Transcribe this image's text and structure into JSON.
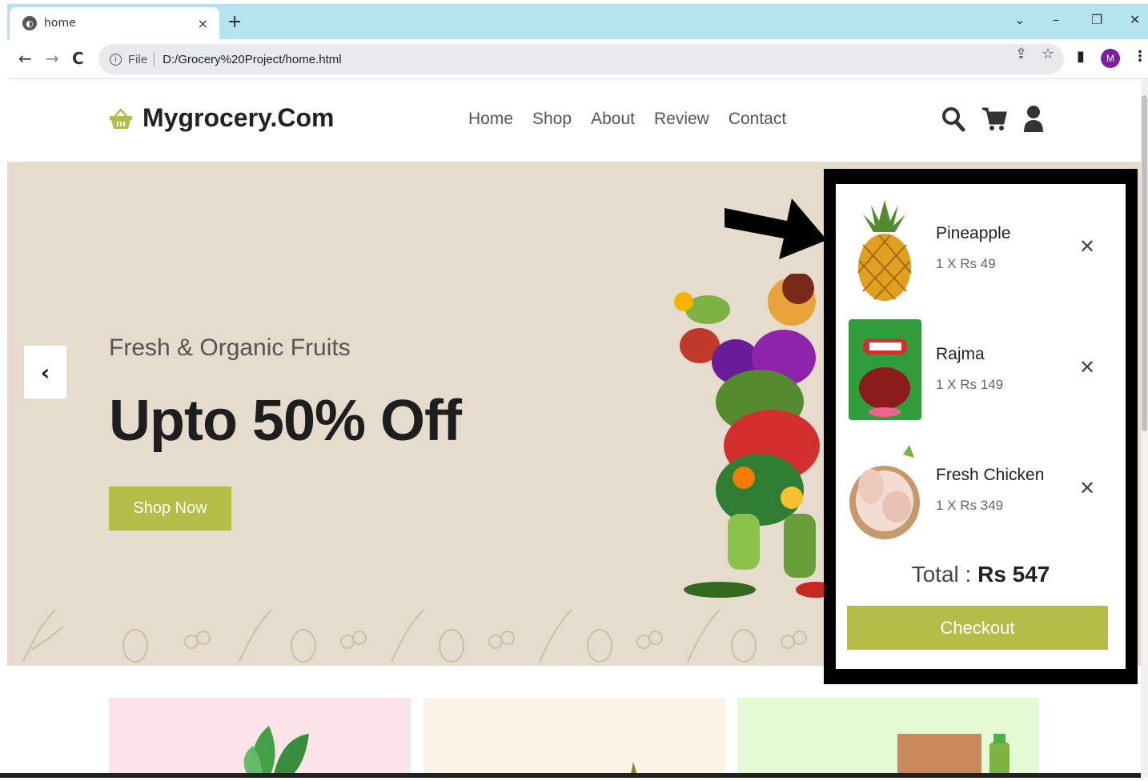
{
  "browser": {
    "tab_title": "home",
    "tab_close": "×",
    "new_tab": "+",
    "url_scheme": "File",
    "url": "D:/Grocery%20Project/home.html",
    "profile_initial": "M"
  },
  "site": {
    "logo_text": "Mygrocery.Com",
    "nav": [
      "Home",
      "Shop",
      "About",
      "Review",
      "Contact"
    ]
  },
  "hero": {
    "subtitle": "Fresh & Organic Fruits",
    "title": "Upto 50% Off",
    "cta": "Shop Now",
    "prev_glyph": "‹"
  },
  "cart": {
    "items": [
      {
        "name": "Pineapple",
        "qty": "1 X Rs 49"
      },
      {
        "name": "Rajma",
        "qty": "1 X Rs 149"
      },
      {
        "name": "Fresh Chicken",
        "qty": "1 X Rs 349"
      }
    ],
    "remove_glyph": "✕",
    "total_label": "Total :",
    "total_value": "Rs 547",
    "checkout_label": "Checkout"
  },
  "colors": {
    "accent": "#b5bc48",
    "hero_bg": "#e5dccd",
    "tabstrip": "#b5e4f0",
    "card1": "#fce4e8",
    "card2": "#fdf3e4",
    "card3": "#e4f9d4"
  }
}
